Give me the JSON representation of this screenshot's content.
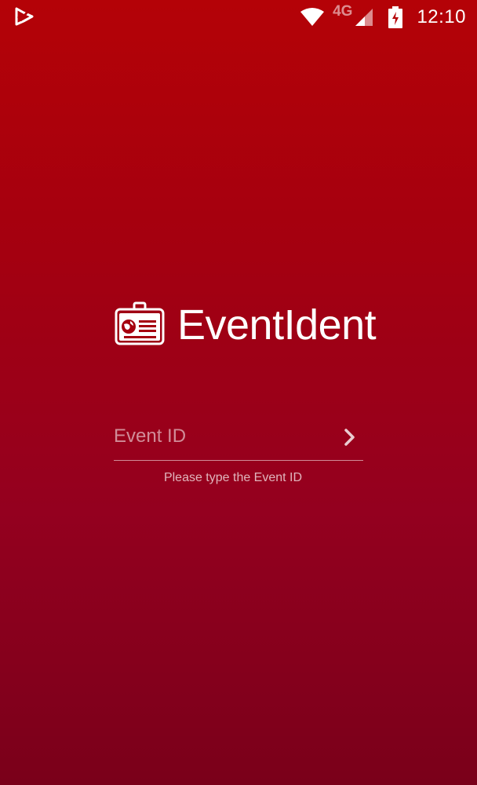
{
  "status_bar": {
    "notification_icon": "app-notification-icon",
    "wifi_icon": "wifi-icon",
    "network_label": "4G",
    "signal_icon": "cell-signal-icon",
    "battery_icon": "battery-charging-icon",
    "time": "12:10"
  },
  "logo": {
    "icon": "id-badge-icon",
    "brand": "EventIdent"
  },
  "form": {
    "event_id_placeholder": "Event ID",
    "event_id_value": "",
    "submit_icon": "chevron-right-icon",
    "helper_text": "Please type the Event ID"
  },
  "colors": {
    "background_top": "#b40207",
    "background_bottom": "#7a001a",
    "text": "#ffffff"
  }
}
